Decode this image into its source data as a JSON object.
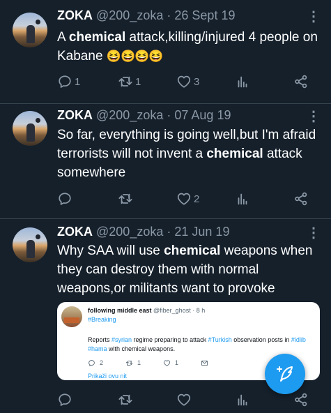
{
  "tweets": [
    {
      "name": "ZOKA",
      "handle": "@200_zoka",
      "separator": "·",
      "date": "26 Sept 19",
      "text_pre": "A ",
      "text_bold": "chemical",
      "text_post": " attack,killing/injured 4 people on Kabane",
      "emojis": "😆😆😆😆",
      "reply_count": "1",
      "retweet_count": "1",
      "like_count": "3"
    },
    {
      "name": "ZOKA",
      "handle": "@200_zoka",
      "separator": "·",
      "date": "07 Aug 19",
      "text_pre": "So far, everything is going well,but I'm afraid terrorists will not invent a ",
      "text_bold": "chemical",
      "text_post": " attack somewhere",
      "reply_count": "",
      "retweet_count": "",
      "like_count": "2"
    },
    {
      "name": "ZOKA",
      "handle": "@200_zoka",
      "separator": "·",
      "date": "21 Jun 19",
      "text_pre": "Why SAA will use ",
      "text_bold": "chemical",
      "text_post": " weapons when they can destroy them with normal weapons,or militants want to provoke",
      "quote": {
        "name": "following middle east",
        "handle": "@fiber_ghost",
        "separator": "·",
        "time": "8 h",
        "tag": "#Breaking",
        "text_1": "Reports ",
        "ht_1": "#syrian",
        "text_2": " regime preparing to attack ",
        "ht_2": "#Turkish",
        "text_3": " observation posts in ",
        "ht_3": "#idlib",
        "text_4": " ",
        "ht_4": "#hama",
        "text_5": " with chemical weapons.",
        "reply_count": "2",
        "retweet_count": "1",
        "like_count": "1",
        "thread_link": "Prikaži ovu nit"
      },
      "reply_count": "",
      "retweet_count": "",
      "like_count": ""
    }
  ],
  "icons": {
    "reply": "reply-icon",
    "retweet": "retweet-icon",
    "like": "heart-icon",
    "views": "analytics-icon",
    "share": "share-icon",
    "more": "more-dots-icon",
    "compose": "compose-icon"
  },
  "colors": {
    "background": "#15202b",
    "divider": "#38444d",
    "secondary_text": "#8b98a5",
    "accent": "#1d9bf0"
  }
}
